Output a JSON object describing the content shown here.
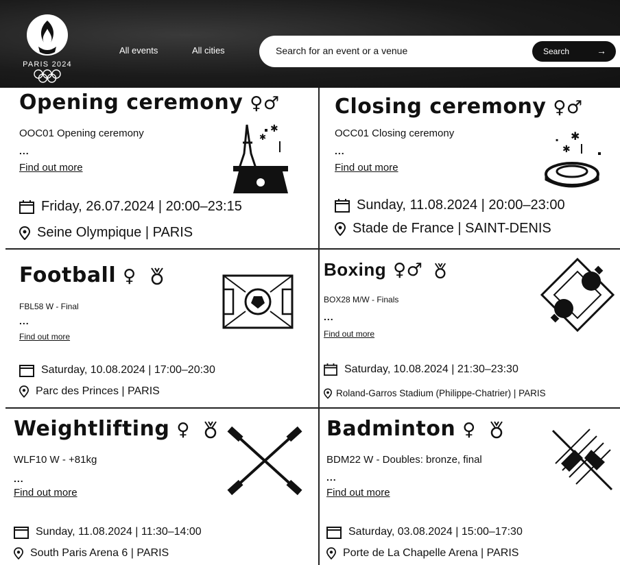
{
  "header": {
    "logo_text": "PARIS 2024",
    "nav": [
      "All events",
      "All cities"
    ],
    "search_placeholder": "Search for an event or a venue",
    "search_button": "Search",
    "search_arrow": "→"
  },
  "events": [
    {
      "title": "Opening ceremony",
      "gender": "♀♂",
      "code": "OOC01 Opening ceremony",
      "dots": "...",
      "more": "Find out more",
      "date": "Friday, 26.07.2024 | 20:00–23:15",
      "venue": "Seine Olympique | PARIS",
      "pictogram": "eiffel-tower-fireworks-icon"
    },
    {
      "title": "Closing ceremony",
      "gender": "♀♂",
      "code": "OCC01 Closing ceremony",
      "dots": "...",
      "more": "Find out more",
      "date": "Sunday, 11.08.2024 | 20:00–23:00",
      "venue": "Stade de France | SAINT-DENIS",
      "pictogram": "stadium-fireworks-icon"
    },
    {
      "title": "Football",
      "gender": "♀",
      "code": "FBL58 W - Final",
      "dots": "...",
      "more": "Find out more",
      "date": "Saturday, 10.08.2024 | 17:00–20:30",
      "venue": "Parc des Princes | PARIS",
      "pictogram": "football-pitch-icon"
    },
    {
      "title": "Boxing",
      "gender": "♀♂",
      "code": "BOX28 M/W - Finals",
      "dots": "...",
      "more": "Find out more",
      "date": "Saturday, 10.08.2024 | 21:30–23:30",
      "venue": "Roland-Garros Stadium (Philippe-Chatrier) | PARIS",
      "pictogram": "boxing-gloves-icon"
    },
    {
      "title": "Weightlifting",
      "gender": "♀",
      "code": "WLF10 W - +81kg",
      "dots": "...",
      "more": "Find out more",
      "date": "Sunday, 11.08.2024 | 11:30–14:00",
      "venue": "South Paris Arena 6 | PARIS",
      "pictogram": "crossed-barbells-icon"
    },
    {
      "title": "Badminton",
      "gender": "♀",
      "code": "BDM22 W - Doubles: bronze, final",
      "dots": "...",
      "more": "Find out more",
      "date": "Saturday, 03.08.2024 | 15:00–17:30",
      "venue": "Porte de La Chapelle Arena | PARIS",
      "pictogram": "shuttlecock-net-icon"
    }
  ]
}
